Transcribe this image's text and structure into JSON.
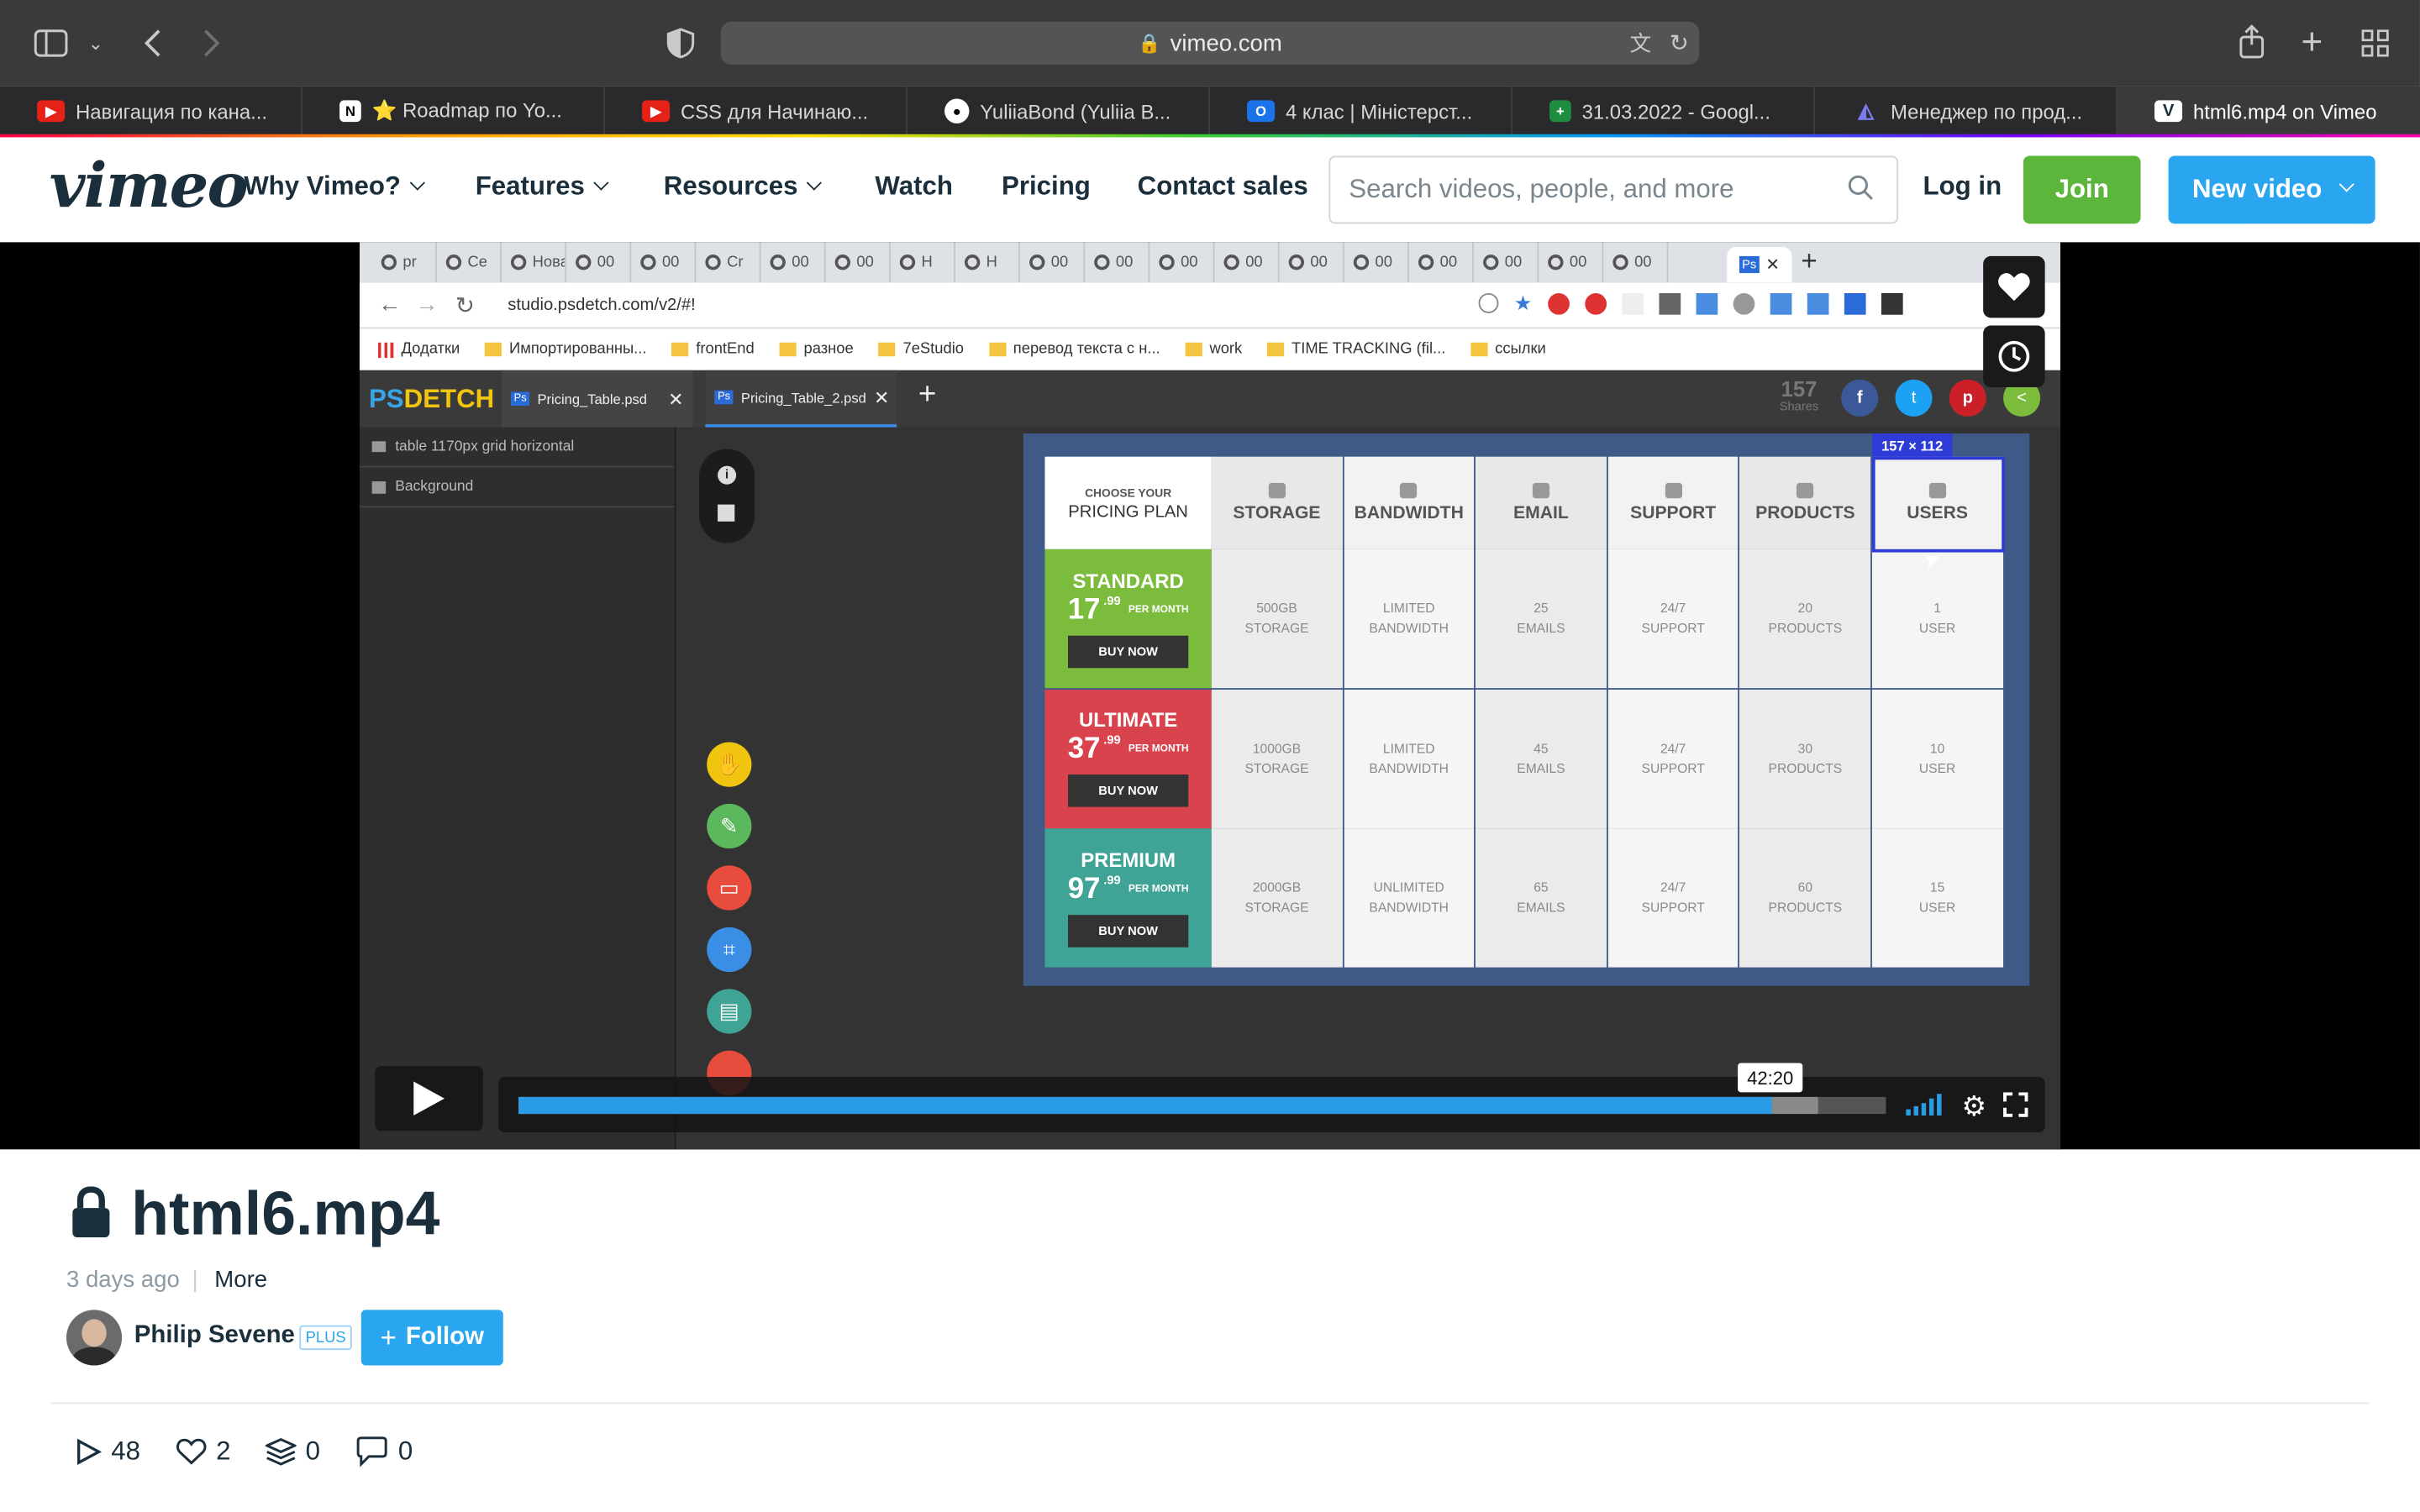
{
  "browser": {
    "url": "vimeo.com",
    "tabs": [
      {
        "label": "Навигация по кана...",
        "icon": "youtube-icon",
        "color": "#e62117"
      },
      {
        "label": "⭐ Roadmap по Yo...",
        "icon": "notion-icon",
        "color": "#ffffff"
      },
      {
        "label": "CSS для Начинаю...",
        "icon": "youtube-icon",
        "color": "#e62117"
      },
      {
        "label": "YuliiaBond (Yuliia B...",
        "icon": "github-icon",
        "color": "#ffffff"
      },
      {
        "label": "4 клас | Міністерст...",
        "icon": "outlook-icon",
        "color": "#1a73e8"
      },
      {
        "label": "31.03.2022 - Googl...",
        "icon": "sheets-icon",
        "color": "#1e8e3e"
      },
      {
        "label": "Менеджер по прод...",
        "icon": "app-icon",
        "color": "#5b5bd6"
      },
      {
        "label": "html6.mp4 on Vimeo",
        "icon": "vimeo-icon",
        "color": "#1ab7ea"
      }
    ]
  },
  "header": {
    "logo": "vimeo",
    "nav": [
      "Why Vimeo?",
      "Features",
      "Resources",
      "Watch",
      "Pricing",
      "Contact sales"
    ],
    "search_placeholder": "Search videos, people, and more",
    "login": "Log in",
    "join": "Join",
    "new_video": "New video"
  },
  "video": {
    "inner_browser": {
      "url": "studio.psdetch.com/v2/#!",
      "tab_snippets": [
        "pr",
        "Ce",
        "Нова",
        "00",
        "00",
        "Cr",
        "00",
        "00",
        "H",
        "H",
        "00",
        "00",
        "00",
        "00",
        "00",
        "00",
        "00",
        "00",
        "00",
        "00"
      ],
      "bookmarks": [
        "Додатки",
        "Импортированны...",
        "frontEnd",
        "разное",
        "7eStudio",
        "перевод текста с н...",
        "work",
        "TIME TRACKING (fil...",
        "ссылки"
      ]
    },
    "psdetch": {
      "logo_a": "PS",
      "logo_b": "DETCH",
      "file_tabs": [
        "Pricing_Table.psd",
        "Pricing_Table_2.psd"
      ],
      "shares": "157",
      "shares_label": "Shares",
      "layers": [
        "table 1170px grid horizontal",
        "Background"
      ],
      "selection_size": "157 × 112"
    },
    "pricing": {
      "header_small": "CHOOSE YOUR",
      "header_big": "PRICING PLAN",
      "columns": [
        "STORAGE",
        "BANDWIDTH",
        "EMAIL",
        "SUPPORT",
        "PRODUCTS",
        "USERS"
      ],
      "per_month": "PER MONTH",
      "buy_now": "BUY NOW",
      "plans": [
        {
          "name": "STANDARD",
          "price": "17",
          "cents": ".99",
          "color": "#7cbc3c",
          "cells": [
            [
              "500GB",
              "STORAGE"
            ],
            [
              "LIMITED",
              "BANDWIDTH"
            ],
            [
              "25",
              "EMAILS"
            ],
            [
              "24/7",
              "SUPPORT"
            ],
            [
              "20",
              "PRODUCTS"
            ],
            [
              "1",
              "USER"
            ]
          ]
        },
        {
          "name": "ULTIMATE",
          "price": "37",
          "cents": ".99",
          "color": "#d9434e",
          "cells": [
            [
              "1000GB",
              "STORAGE"
            ],
            [
              "LIMITED",
              "BANDWIDTH"
            ],
            [
              "45",
              "EMAILS"
            ],
            [
              "24/7",
              "SUPPORT"
            ],
            [
              "30",
              "PRODUCTS"
            ],
            [
              "10",
              "USER"
            ]
          ]
        },
        {
          "name": "PREMIUM",
          "price": "97",
          "cents": ".99",
          "color": "#3fa395",
          "cells": [
            [
              "2000GB",
              "STORAGE"
            ],
            [
              "UNLIMITED",
              "BANDWIDTH"
            ],
            [
              "65",
              "EMAILS"
            ],
            [
              "24/7",
              "SUPPORT"
            ],
            [
              "60",
              "PRODUCTS"
            ],
            [
              "15",
              "USER"
            ]
          ]
        }
      ]
    },
    "player": {
      "hover_time": "42:20",
      "progress_fraction": 0.916,
      "buffered_fraction": 0.95
    }
  },
  "info": {
    "title": "html6.mp4",
    "age": "3 days ago",
    "more": "More",
    "owner": "Philip Sevene",
    "badge": "PLUS",
    "follow": "Follow",
    "stats": {
      "plays": "48",
      "likes": "2",
      "collections": "0",
      "comments": "0"
    }
  }
}
